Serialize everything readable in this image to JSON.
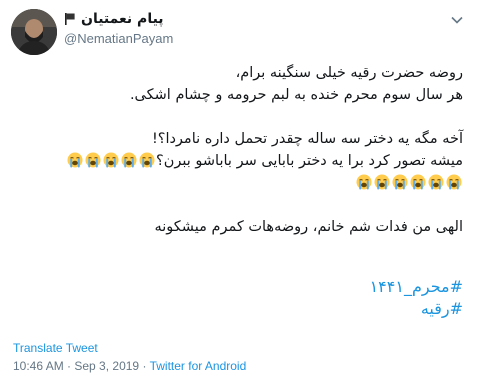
{
  "author": {
    "name": "پیام نعمتیان",
    "handle": "@NematianPayam"
  },
  "tweet": {
    "line1": "روضه حضرت رقیه خیلی سنگینه برام،",
    "line2": "هر سال سوم محرم خنده به لبم حرومه و چشام اشکی.",
    "line3": "آخه مگه یه دختر سه ساله چقدر تحمل داره نامردا؟!",
    "line4": "میشه تصور کرد برا یه دختر بابایی سر باباشو ببرن؟",
    "line5": "الهی من فدات شم خانم، روضه‌هات کمرم میشکونه",
    "hashtag1": "#محرم_۱۴۴۱",
    "hashtag2": "#رقیه"
  },
  "actions": {
    "translate": "Translate Tweet"
  },
  "meta": {
    "time": "10:46 AM",
    "separator1": " · ",
    "date": "Sep 3, 2019",
    "separator2": " · ",
    "source": "Twitter for Android"
  },
  "emoji": {
    "name": "loudly-crying-face",
    "line4_count": 5,
    "line4b_count": 6
  },
  "colors": {
    "link": "#1b95e0",
    "muted": "#657786",
    "text": "#14171a"
  }
}
